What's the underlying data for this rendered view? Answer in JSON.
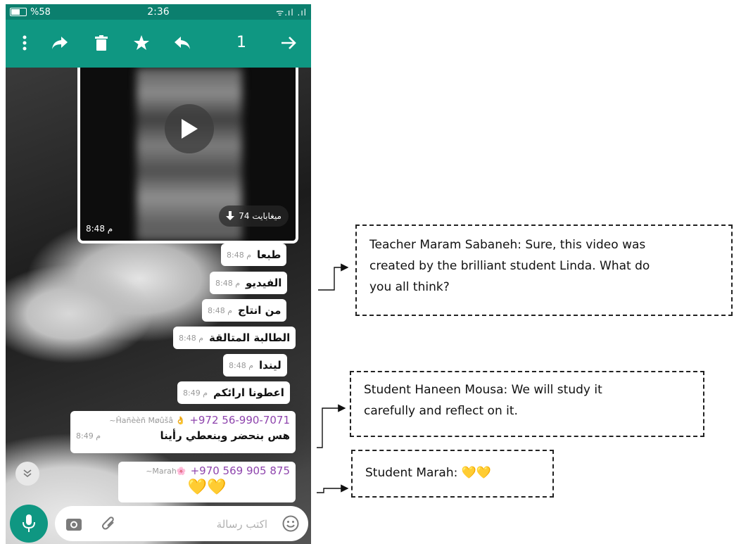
{
  "status_bar": {
    "battery": "%58",
    "time": "2:36",
    "signal": "ᯤ.ıl .ıl"
  },
  "toolbar": {
    "selected_count": "1",
    "icons": [
      "more-vert-icon",
      "forward-icon",
      "delete-icon",
      "star-icon",
      "reply-icon",
      "arrow-right-icon"
    ]
  },
  "video": {
    "size_label": "74 ميغابايت",
    "time": "8:48 م"
  },
  "messages": [
    {
      "text": "طبعا",
      "time": "8:48 م"
    },
    {
      "text": "الفيديو",
      "time": "8:48 م"
    },
    {
      "text": "من انتاج",
      "time": "8:48 م"
    },
    {
      "text": "الطالبة المتالقة",
      "time": "8:48 م"
    },
    {
      "text": "ليندا",
      "time": "8:48 م"
    },
    {
      "text": "اعطونا ارائكم",
      "time": "8:49 م"
    }
  ],
  "group_messages": [
    {
      "sender_name": "~Ĥañèèñ Møûšâ 👌",
      "sender_phone": "+972 56-990-7071",
      "text": "هس بنحضر وبنعطي رأينا",
      "time": "8:49 م"
    },
    {
      "sender_name": "~Marah🌸",
      "sender_phone": "+970 569 905 875",
      "text": "💛💛"
    }
  ],
  "input": {
    "placeholder": "اكتب رسالة"
  },
  "annotations": {
    "teacher": [
      "Teacher Maram Sabaneh: Sure, this video was",
      "created by the brilliant student Linda. What do",
      "you all think?"
    ],
    "haneen": [
      "Student Haneen Mousa: We will study it",
      "carefully and reflect on it."
    ],
    "marah": "Student Marah: 💛💛"
  },
  "colors": {
    "header": "#0f9782",
    "status": "#0b7f6e",
    "sender_phone": "#8e44ad"
  }
}
